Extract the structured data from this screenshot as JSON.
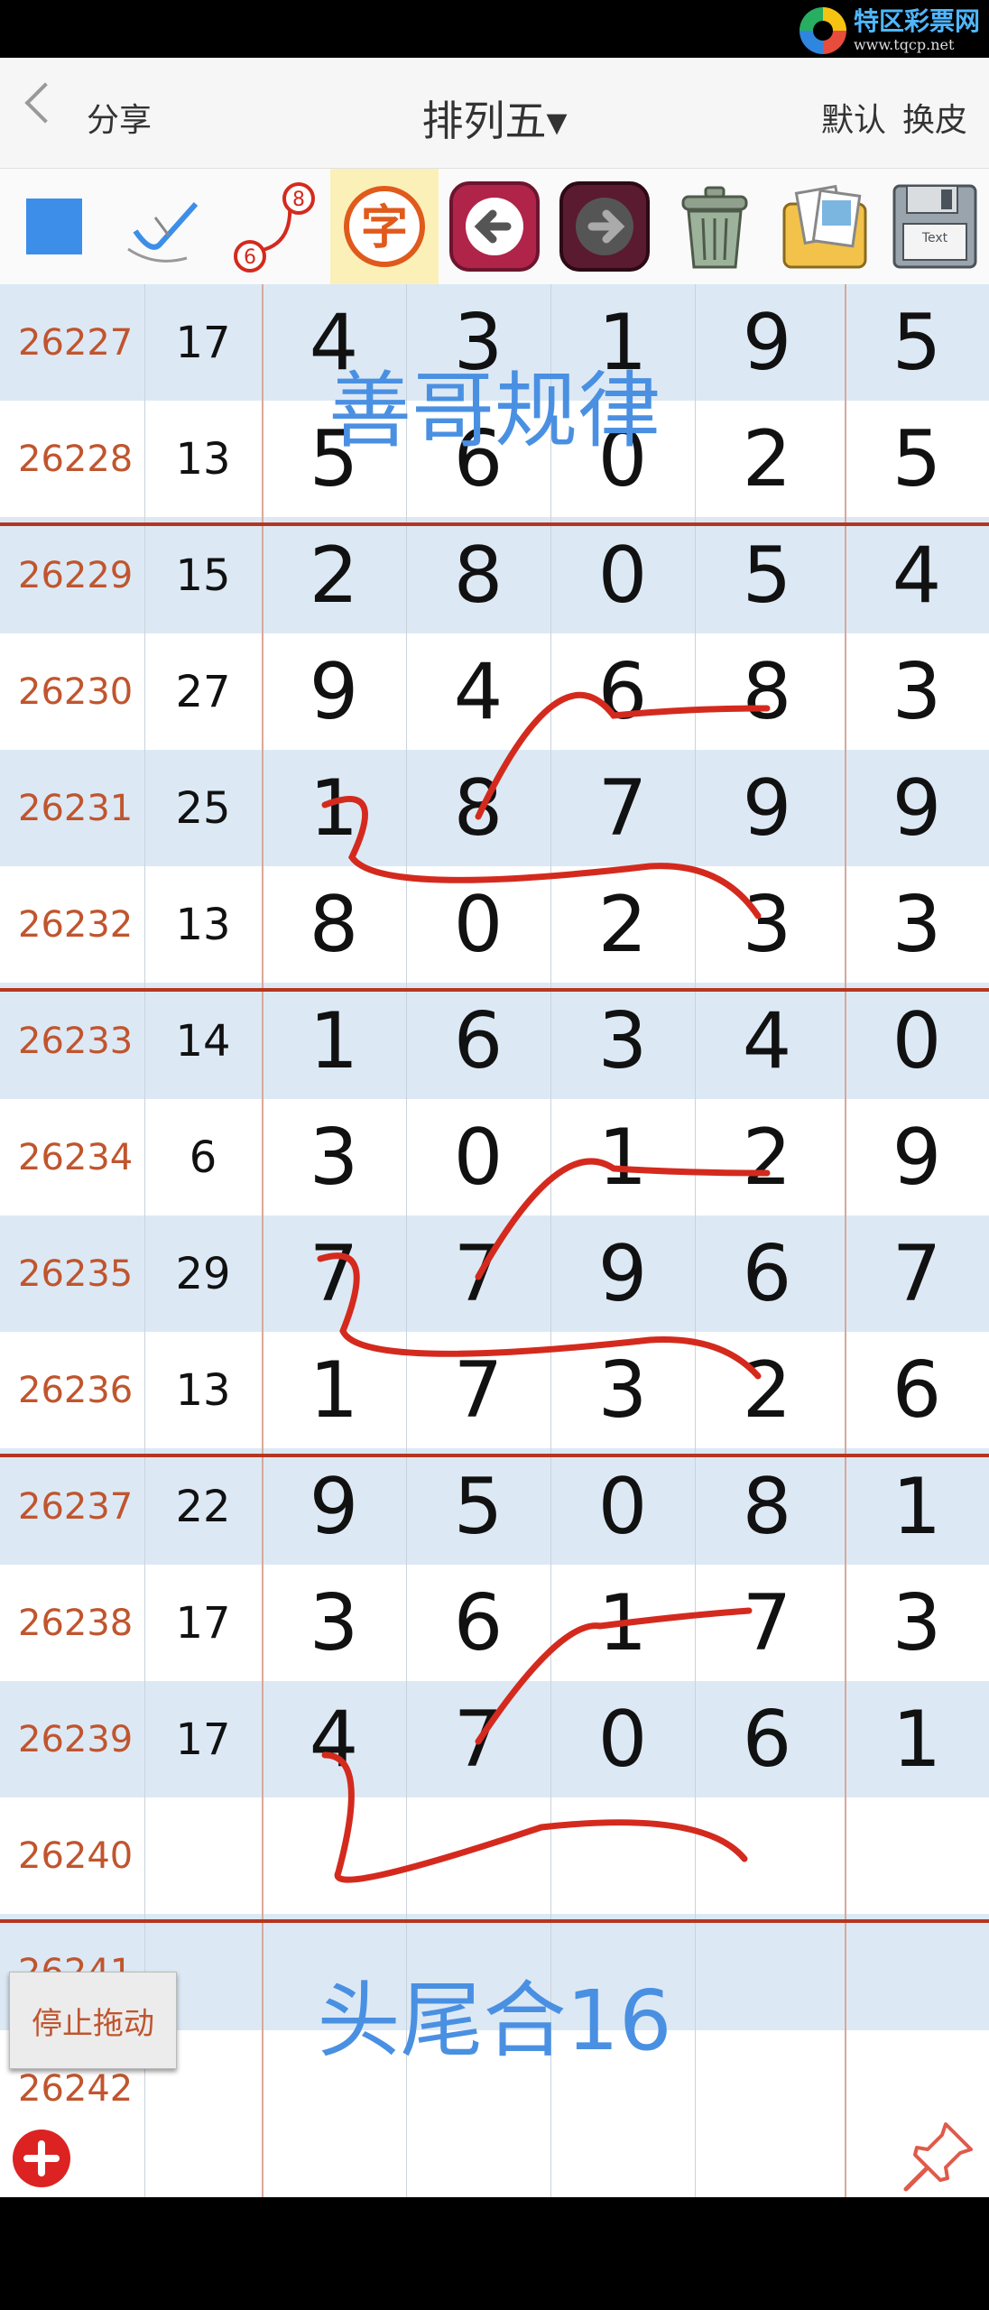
{
  "logo": {
    "title": "特区彩票网",
    "url": "www.tqcp.net"
  },
  "nav": {
    "back_label": "分享",
    "title": "排列五",
    "title_arrow": "▾",
    "default_label": "默认",
    "skin_label": "换皮"
  },
  "toolbar": {
    "icons": [
      "square-icon",
      "pen-icon",
      "curve-icon",
      "text-icon",
      "undo-icon",
      "redo-icon",
      "trash-icon",
      "photos-icon",
      "save-icon"
    ],
    "curve_badge_top": "8",
    "curve_badge_bottom": "6",
    "text_icon_label": "字",
    "save_label": "Text"
  },
  "rows": [
    {
      "issue": "26227",
      "sum": "17",
      "d": [
        "4",
        "3",
        "1",
        "9",
        "5"
      ]
    },
    {
      "issue": "26228",
      "sum": "13",
      "d": [
        "5",
        "6",
        "0",
        "2",
        "5"
      ]
    },
    {
      "issue": "26229",
      "sum": "15",
      "d": [
        "2",
        "8",
        "0",
        "5",
        "4"
      ]
    },
    {
      "issue": "26230",
      "sum": "27",
      "d": [
        "9",
        "4",
        "6",
        "8",
        "3"
      ]
    },
    {
      "issue": "26231",
      "sum": "25",
      "d": [
        "1",
        "8",
        "7",
        "9",
        "9"
      ]
    },
    {
      "issue": "26232",
      "sum": "13",
      "d": [
        "8",
        "0",
        "2",
        "3",
        "3"
      ]
    },
    {
      "issue": "26233",
      "sum": "14",
      "d": [
        "1",
        "6",
        "3",
        "4",
        "0"
      ]
    },
    {
      "issue": "26234",
      "sum": "6",
      "d": [
        "3",
        "0",
        "1",
        "2",
        "9"
      ]
    },
    {
      "issue": "26235",
      "sum": "29",
      "d": [
        "7",
        "7",
        "9",
        "6",
        "7"
      ]
    },
    {
      "issue": "26236",
      "sum": "13",
      "d": [
        "1",
        "7",
        "3",
        "2",
        "6"
      ]
    },
    {
      "issue": "26237",
      "sum": "22",
      "d": [
        "9",
        "5",
        "0",
        "8",
        "1"
      ]
    },
    {
      "issue": "26238",
      "sum": "17",
      "d": [
        "3",
        "6",
        "1",
        "7",
        "3"
      ]
    },
    {
      "issue": "26239",
      "sum": "17",
      "d": [
        "4",
        "7",
        "0",
        "6",
        "1"
      ]
    },
    {
      "issue": "26240",
      "sum": "",
      "d": [
        "",
        "",
        "",
        "",
        ""
      ]
    },
    {
      "issue": "26241",
      "sum": "",
      "d": [
        "",
        "",
        "",
        "",
        ""
      ]
    },
    {
      "issue": "26242",
      "sum": "",
      "d": [
        "",
        "",
        "",
        "",
        ""
      ]
    }
  ],
  "annotations": {
    "top_text": "善哥规律",
    "bottom_text": "头尾合16",
    "stroke_color": "#d42a1e"
  },
  "floating": {
    "stop_drag_label": "停止拖动"
  },
  "colors": {
    "row_alt": "#dce9f5",
    "issue_text": "#c0552e",
    "separator": "#b5361f",
    "annotation_blue": "#4a90e2"
  }
}
